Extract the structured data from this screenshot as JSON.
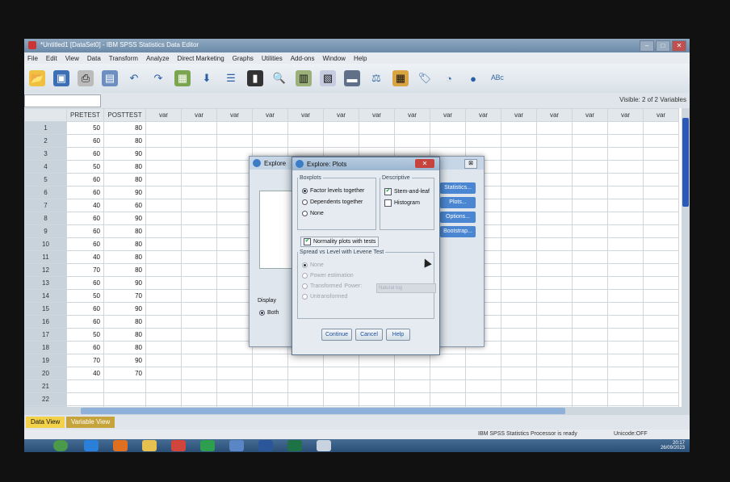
{
  "window": {
    "title": "*Untitled1 [DataSet0] - IBM SPSS Statistics Data Editor",
    "controls": [
      "minimize",
      "maximize",
      "close"
    ]
  },
  "menu": [
    "File",
    "Edit",
    "View",
    "Data",
    "Transform",
    "Analyze",
    "Direct Marketing",
    "Graphs",
    "Utilities",
    "Add-ons",
    "Window",
    "Help"
  ],
  "toolbar_icons": [
    "open-icon",
    "save-icon",
    "print-icon",
    "dialog-recall-icon",
    "undo-icon",
    "redo-icon",
    "goto-case-icon",
    "goto-variable-icon",
    "variables-icon",
    "run-descriptive-icon",
    "find-icon",
    "insert-cases-icon",
    "insert-variable-icon",
    "split-file-icon",
    "weight-cases-icon",
    "select-cases-icon",
    "value-labels-icon",
    "use-sets-icon",
    "show-all-icon",
    "spelling-icon"
  ],
  "infobar": {
    "visible": "Visible: 2 of 2 Variables"
  },
  "grid": {
    "columns": [
      "PRETEST",
      "POSTTEST",
      "var",
      "var",
      "var",
      "var",
      "var",
      "var",
      "var",
      "var",
      "var",
      "var",
      "var",
      "var",
      "var",
      "var",
      "var"
    ],
    "rows": [
      [
        "1",
        "50",
        "80"
      ],
      [
        "2",
        "60",
        "80"
      ],
      [
        "3",
        "60",
        "90"
      ],
      [
        "4",
        "50",
        "80"
      ],
      [
        "5",
        "60",
        "80"
      ],
      [
        "6",
        "60",
        "90"
      ],
      [
        "7",
        "40",
        "60"
      ],
      [
        "8",
        "60",
        "90"
      ],
      [
        "9",
        "60",
        "80"
      ],
      [
        "10",
        "60",
        "80"
      ],
      [
        "11",
        "40",
        "80"
      ],
      [
        "12",
        "70",
        "80"
      ],
      [
        "13",
        "60",
        "90"
      ],
      [
        "14",
        "50",
        "70"
      ],
      [
        "15",
        "60",
        "90"
      ],
      [
        "16",
        "60",
        "80"
      ],
      [
        "17",
        "50",
        "80"
      ],
      [
        "18",
        "60",
        "80"
      ],
      [
        "19",
        "70",
        "90"
      ],
      [
        "20",
        "40",
        "70"
      ],
      [
        "21",
        "",
        ""
      ],
      [
        "22",
        "",
        ""
      ],
      [
        "23",
        "",
        ""
      ]
    ]
  },
  "tabs": {
    "data_view": "Data View",
    "variable_view": "Variable View"
  },
  "status": {
    "processor": "IBM SPSS Statistics Processor is ready",
    "unicode": "Unicode:OFF"
  },
  "tray": {
    "time": "20:17",
    "date": "26/09/2023"
  },
  "explore_dialog": {
    "title": "Explore",
    "side_buttons": [
      "Statistics...",
      "Plots...",
      "Options...",
      "Bootstrap..."
    ],
    "display_label": "Display",
    "both_option": "Both"
  },
  "plots_dialog": {
    "title": "Explore: Plots",
    "boxplots": {
      "legend": "Boxplots",
      "options": [
        "Factor levels together",
        "Dependents together",
        "None"
      ],
      "selected": "Factor levels together"
    },
    "descriptive": {
      "legend": "Descriptive",
      "stem_and_leaf": "Stem-and-leaf",
      "histogram": "Histogram"
    },
    "normality": "Normality plots with tests",
    "spread": {
      "legend": "Spread vs Level with Levene Test",
      "options": [
        "None",
        "Power estimation",
        "Transformed",
        "Untransformed"
      ],
      "power_label": "Power:",
      "power_value": "Natural log"
    },
    "buttons": {
      "continue": "Continue",
      "cancel": "Cancel",
      "help": "Help"
    }
  }
}
